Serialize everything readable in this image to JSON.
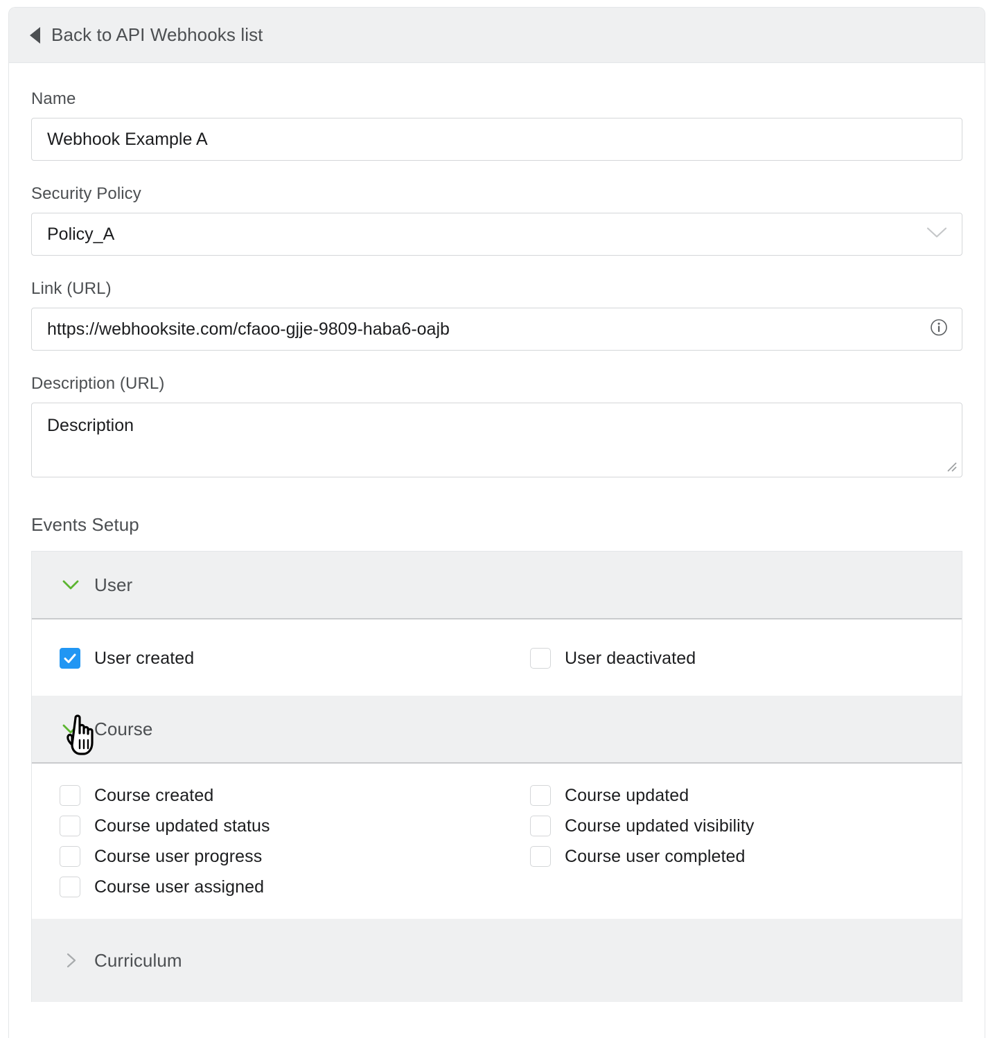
{
  "header": {
    "back_label": "Back to API Webhooks list",
    "back_icon": "triangle-left-icon"
  },
  "form": {
    "name": {
      "label": "Name",
      "value": "Webhook Example A",
      "placeholder": "Name"
    },
    "security_policy": {
      "label": "Security Policy",
      "value": "Policy_A",
      "options": [
        "Policy_A"
      ],
      "chevron_icon": "chevron-down-icon"
    },
    "link_url": {
      "label": "Link (URL)",
      "value": "https://webhooksite.com/cfaoo-gjje-9809-haba6-oajb",
      "placeholder": "Link (URL)",
      "info_icon": "info-circle-icon"
    },
    "description": {
      "label": "Description (URL)",
      "value": "Description",
      "placeholder": "Description"
    }
  },
  "events_setup": {
    "title": "Events Setup",
    "sections": [
      {
        "name": "User",
        "expanded": true,
        "chevron_icon": "chevron-down-icon",
        "events": [
          {
            "label": "User created",
            "checked": true
          },
          {
            "label": "User deactivated",
            "checked": false
          }
        ]
      },
      {
        "name": "Course",
        "expanded": true,
        "chevron_icon": "chevron-down-icon",
        "events": [
          {
            "label": "Course created",
            "checked": false
          },
          {
            "label": "Course updated",
            "checked": false
          },
          {
            "label": "Course updated status",
            "checked": false
          },
          {
            "label": "Course updated visibility",
            "checked": false
          },
          {
            "label": "Course user progress",
            "checked": false
          },
          {
            "label": "Course user completed",
            "checked": false
          },
          {
            "label": "Course user assigned",
            "checked": false
          }
        ]
      },
      {
        "name": "Curriculum",
        "expanded": false,
        "chevron_icon": "chevron-right-icon",
        "events": []
      }
    ]
  },
  "colors": {
    "accent_blue": "#2196f3",
    "chevron_green": "#5cb531",
    "header_bg": "#eff0f1",
    "text": "#4c4f52",
    "border": "#d4d6d8"
  },
  "cursor": {
    "icon": "pointing-hand-cursor"
  }
}
